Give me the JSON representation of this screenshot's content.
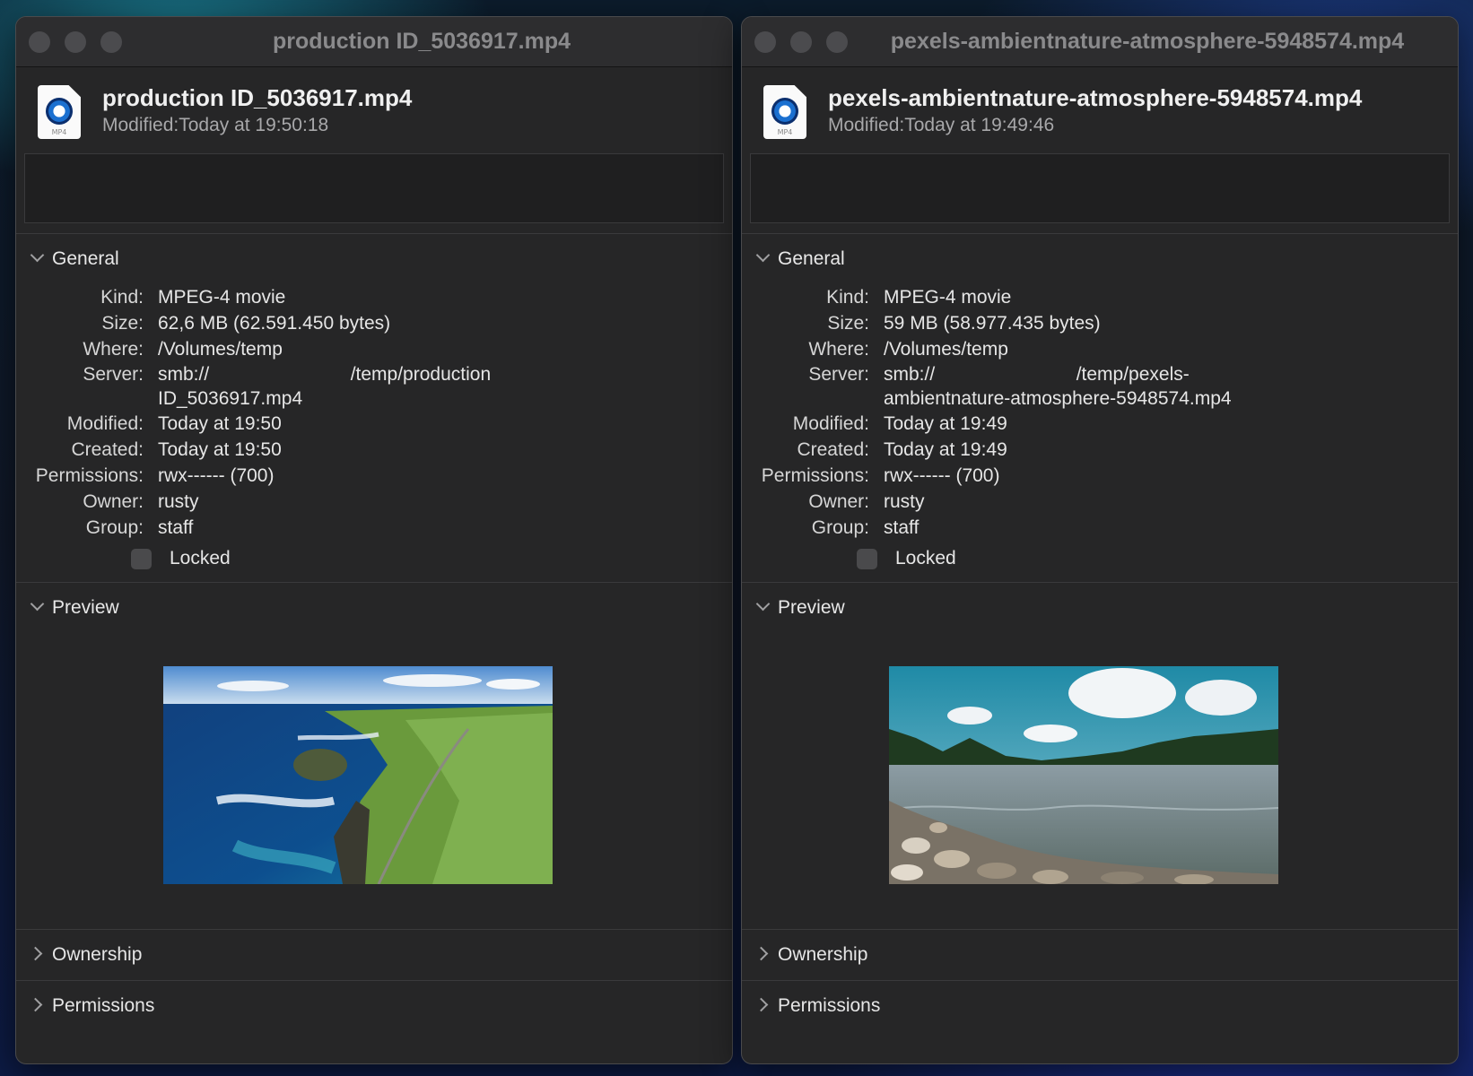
{
  "windows": [
    {
      "title": "production ID_5036917.mp4",
      "file_name": "production ID_5036917.mp4",
      "modified_header": "Modified:Today at 19:50:18",
      "icon_ext": "MP4",
      "sections": {
        "general": "General",
        "preview": "Preview",
        "ownership": "Ownership",
        "permissions": "Permissions"
      },
      "info": {
        "kind_label": "Kind:",
        "kind": "MPEG-4 movie",
        "size_label": "Size:",
        "size": "62,6 MB (62.591.450 bytes)",
        "where_label": "Where:",
        "where": "/Volumes/temp",
        "server_label": "Server:",
        "server_line1": "smb://                           /temp/production",
        "server_line2": "ID_5036917.mp4",
        "modified_label": "Modified:",
        "modified": "Today at 19:50",
        "created_label": "Created:",
        "created": "Today at 19:50",
        "permissions_label": "Permissions:",
        "permissions": "rwx------ (700)",
        "owner_label": "Owner:",
        "owner": "rusty",
        "group_label": "Group:",
        "group": "staff",
        "locked_label": "Locked"
      },
      "preview_subject": "aerial coastline cliffs"
    },
    {
      "title": "pexels-ambientnature-atmosphere-5948574.mp4",
      "file_name": "pexels-ambientnature-atmosphere-5948574.mp4",
      "modified_header": "Modified:Today at 19:49:46",
      "icon_ext": "MP4",
      "sections": {
        "general": "General",
        "preview": "Preview",
        "ownership": "Ownership",
        "permissions": "Permissions"
      },
      "info": {
        "kind_label": "Kind:",
        "kind": "MPEG-4 movie",
        "size_label": "Size:",
        "size": "59 MB (58.977.435 bytes)",
        "where_label": "Where:",
        "where": "/Volumes/temp",
        "server_label": "Server:",
        "server_line1": "smb://                           /temp/pexels-",
        "server_line2": "ambientnature-atmosphere-5948574.mp4",
        "modified_label": "Modified:",
        "modified": "Today at 19:49",
        "created_label": "Created:",
        "created": "Today at 19:49",
        "permissions_label": "Permissions:",
        "permissions": "rwx------ (700)",
        "owner_label": "Owner:",
        "owner": "rusty",
        "group_label": "Group:",
        "group": "staff",
        "locked_label": "Locked"
      },
      "preview_subject": "river with pebbles and clouds"
    }
  ],
  "colors": {
    "window_bg": "#262627",
    "titlebar_bg": "#2d2d2f",
    "traffic_light_inactive": "#4b4b4e"
  }
}
